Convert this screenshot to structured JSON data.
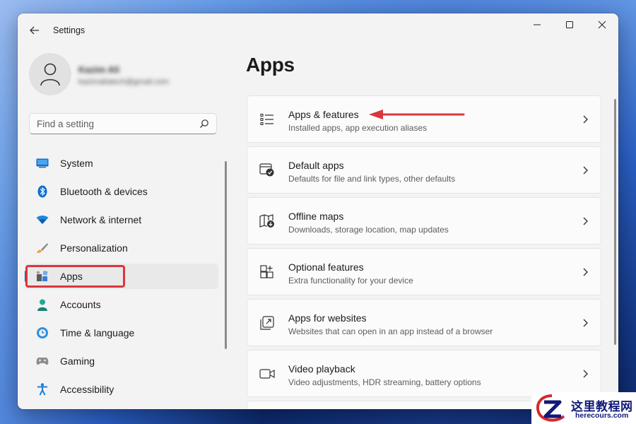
{
  "window": {
    "title": "Settings"
  },
  "user": {
    "name": "Kazim Ali",
    "email": "kazimaliatech@gmail.com"
  },
  "search": {
    "placeholder": "Find a setting"
  },
  "nav": {
    "items": [
      {
        "label": "System",
        "icon": "monitor-icon"
      },
      {
        "label": "Bluetooth & devices",
        "icon": "bluetooth-icon"
      },
      {
        "label": "Network & internet",
        "icon": "wifi-icon"
      },
      {
        "label": "Personalization",
        "icon": "brush-icon"
      },
      {
        "label": "Apps",
        "icon": "apps-icon",
        "selected": true
      },
      {
        "label": "Accounts",
        "icon": "person-icon"
      },
      {
        "label": "Time & language",
        "icon": "globe-clock-icon"
      },
      {
        "label": "Gaming",
        "icon": "gamepad-icon"
      },
      {
        "label": "Accessibility",
        "icon": "accessibility-icon"
      }
    ]
  },
  "main": {
    "title": "Apps",
    "cards": [
      {
        "title": "Apps & features",
        "subtitle": "Installed apps, app execution aliases",
        "icon": "list-icon"
      },
      {
        "title": "Default apps",
        "subtitle": "Defaults for file and link types, other defaults",
        "icon": "default-apps-icon"
      },
      {
        "title": "Offline maps",
        "subtitle": "Downloads, storage location, map updates",
        "icon": "map-download-icon"
      },
      {
        "title": "Optional features",
        "subtitle": "Extra functionality for your device",
        "icon": "add-grid-icon"
      },
      {
        "title": "Apps for websites",
        "subtitle": "Websites that can open in an app instead of a browser",
        "icon": "open-link-icon"
      },
      {
        "title": "Video playback",
        "subtitle": "Video adjustments, HDR streaming, battery options",
        "icon": "video-icon"
      }
    ]
  },
  "watermark": {
    "text": "这里教程网",
    "url": "herecours.com"
  },
  "colors": {
    "accent": "#005fb8",
    "highlight": "#d9363e",
    "background": "#f3f3f3"
  }
}
